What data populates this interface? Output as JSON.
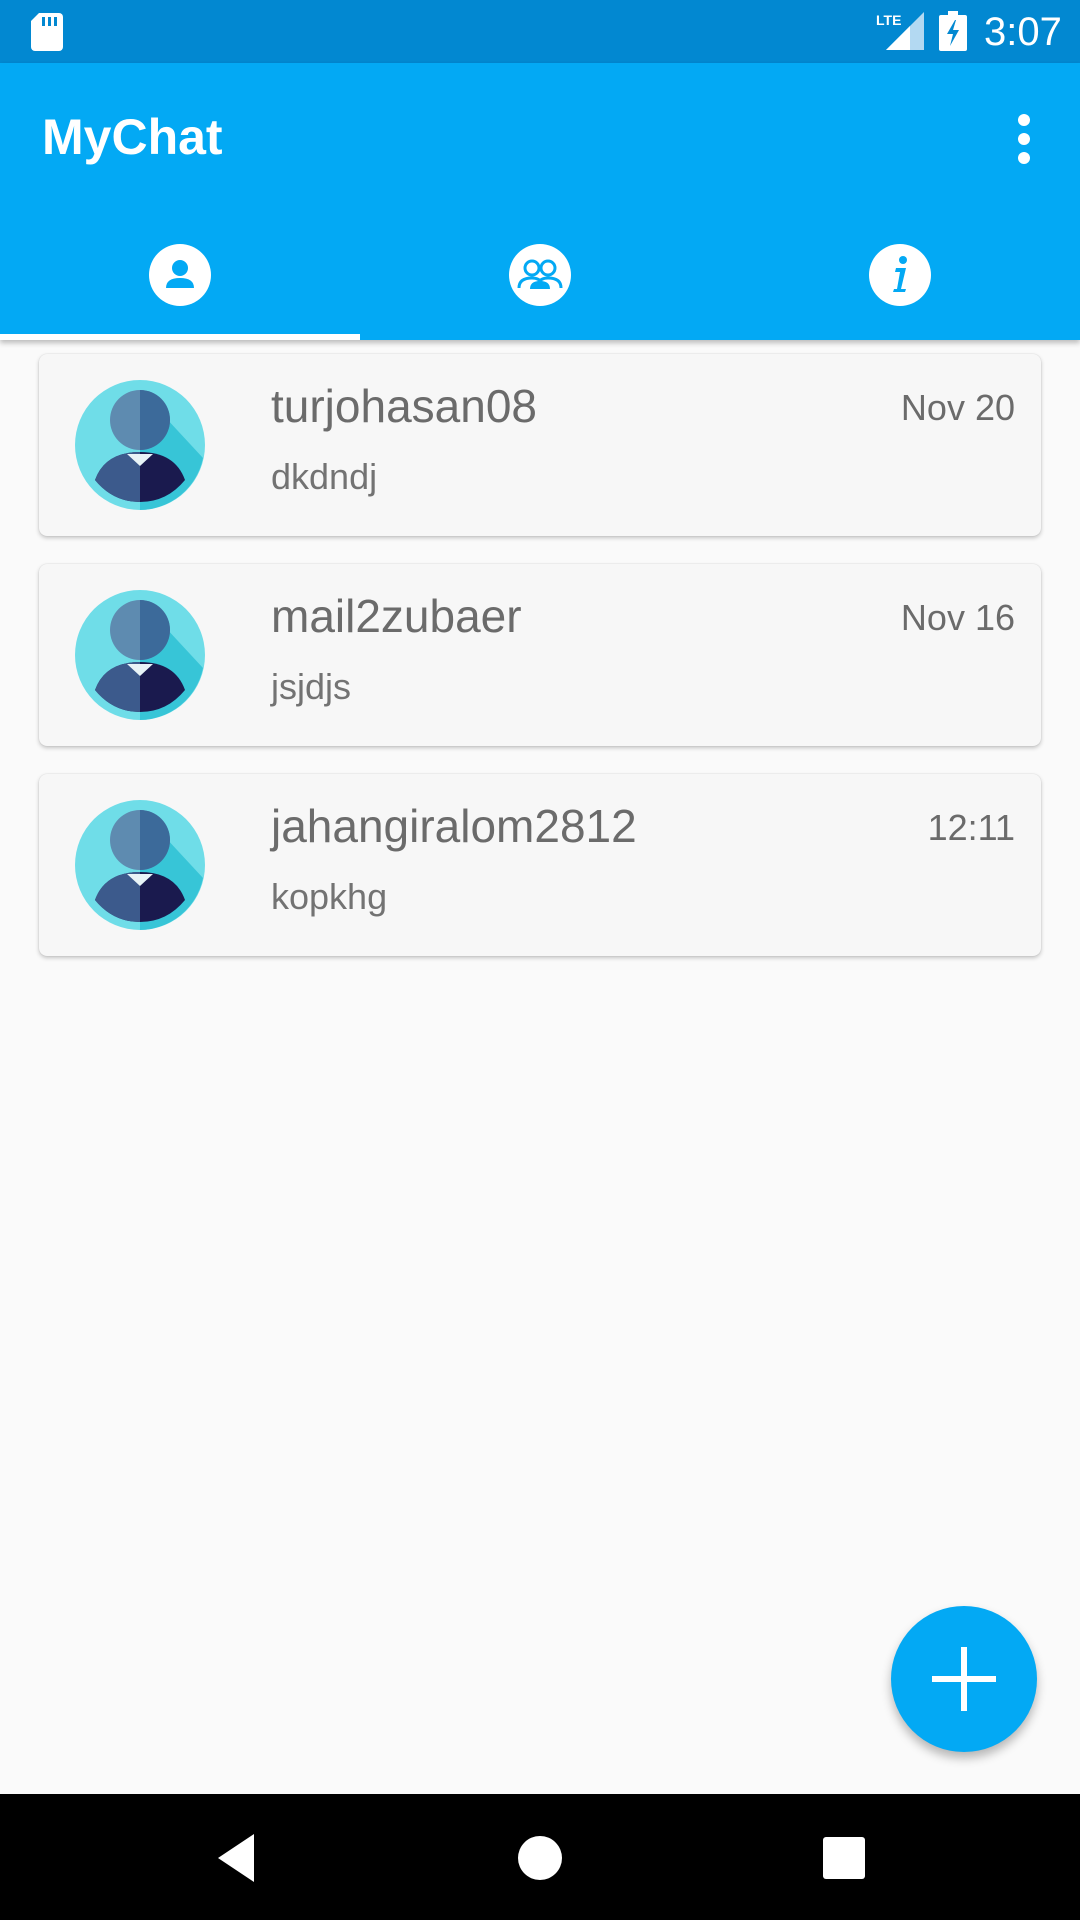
{
  "status_bar": {
    "network_label": "LTE",
    "time": "3:07",
    "icons": [
      "sd-card-icon",
      "lte-signal-icon",
      "battery-charging-icon"
    ]
  },
  "app_bar": {
    "title": "MyChat",
    "menu_icon": "more-vert-icon",
    "tabs": [
      {
        "icon": "person-icon",
        "selected": true
      },
      {
        "icon": "group-icon",
        "selected": false
      },
      {
        "icon": "info-icon",
        "selected": false
      }
    ]
  },
  "conversations": [
    {
      "name": "turjohasan08",
      "message": "dkdndj",
      "time": "Nov 20"
    },
    {
      "name": "mail2zubaer",
      "message": "jsjdjs",
      "time": "Nov 16"
    },
    {
      "name": "jahangiralom2812",
      "message": "kopkhg",
      "time": "12:11"
    }
  ],
  "fab": {
    "icon": "add-icon"
  },
  "nav_bar": {
    "icons": [
      "back-icon",
      "home-icon",
      "recents-icon"
    ]
  },
  "colors": {
    "primary": "#03a9f4",
    "primary_dark": "#0288d1",
    "background": "#fafafa",
    "card": "#f7f7f7",
    "text_secondary": "#6b6b6b"
  }
}
